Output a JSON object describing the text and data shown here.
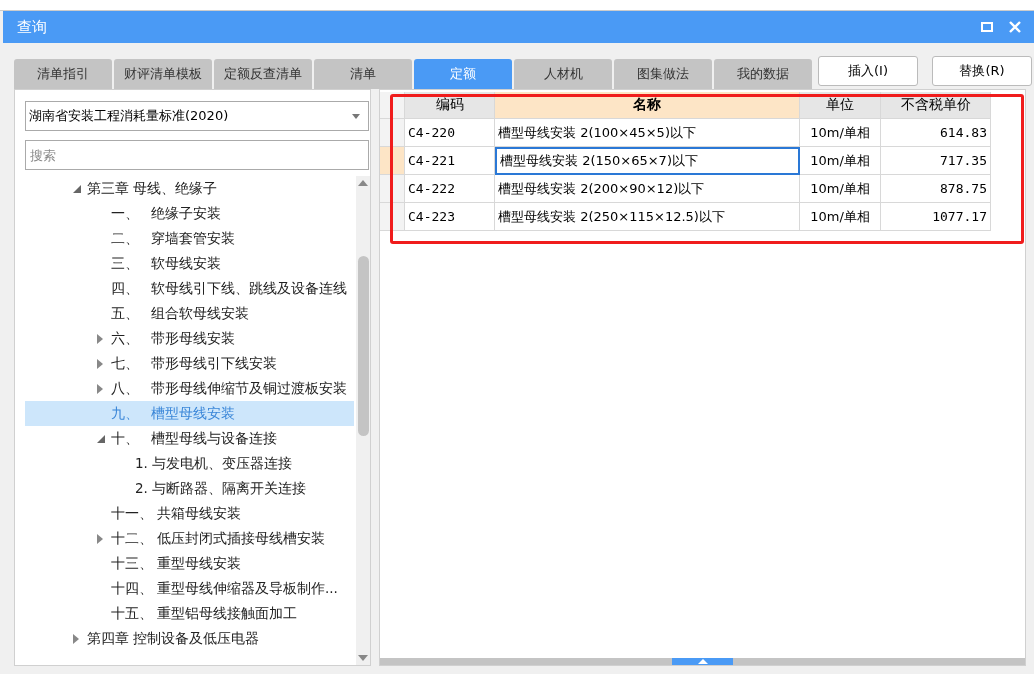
{
  "window": {
    "title": "查询"
  },
  "tabs": [
    {
      "label": "清单指引",
      "selected": false
    },
    {
      "label": "财评清单模板",
      "selected": false
    },
    {
      "label": "定额反查清单",
      "selected": false
    },
    {
      "label": "清单",
      "selected": false
    },
    {
      "label": "定额",
      "selected": true
    },
    {
      "label": "人材机",
      "selected": false
    },
    {
      "label": "图集做法",
      "selected": false
    },
    {
      "label": "我的数据",
      "selected": false
    }
  ],
  "buttons": [
    "插入(I)",
    "替换(R)"
  ],
  "library_select": {
    "value": "湖南省安装工程消耗量标准(2020)"
  },
  "search": {
    "placeholder": "搜索"
  },
  "tree": [
    {
      "label": "第三章 母线、绝缘子",
      "expanded": true,
      "selected": false,
      "children": [
        {
          "number": "一、",
          "label": "绝缘子安装",
          "selected": false
        },
        {
          "number": "二、",
          "label": "穿墙套管安装",
          "selected": false
        },
        {
          "number": "三、",
          "label": "软母线安装",
          "selected": false
        },
        {
          "number": "四、",
          "label": "软母线引下线、跳线及设备连线",
          "selected": false
        },
        {
          "number": "五、",
          "label": "组合软母线安装",
          "selected": false
        },
        {
          "number": "六、",
          "label": "带形母线安装",
          "expanded": false,
          "selected": false
        },
        {
          "number": "七、",
          "label": "带形母线引下线安装",
          "expanded": false,
          "selected": false
        },
        {
          "number": "八、",
          "label": "带形母线伸缩节及铜过渡板安装",
          "expanded": false,
          "selected": false
        },
        {
          "number": "九、",
          "label": "槽型母线安装",
          "selected": true
        },
        {
          "number": "十、",
          "label": "槽型母线与设备连接",
          "expanded": true,
          "selected": false,
          "children": [
            {
              "label": "1. 与发电机、变压器连接",
              "selected": false
            },
            {
              "label": "2. 与断路器、隔离开关连接",
              "selected": false
            }
          ]
        },
        {
          "number": "十一、",
          "label": "共箱母线安装",
          "selected": false
        },
        {
          "number": "十二、",
          "label": "低压封闭式插接母线槽安装",
          "expanded": false,
          "selected": false
        },
        {
          "number": "十三、",
          "label": "重型母线安装",
          "selected": false
        },
        {
          "number": "十四、",
          "label": "重型母线伸缩器及导板制作...",
          "selected": false
        },
        {
          "number": "十五、",
          "label": "重型铝母线接触面加工",
          "selected": false
        }
      ]
    },
    {
      "label": "第四章 控制设备及低压电器",
      "expanded": false,
      "selected": false
    }
  ],
  "table": {
    "columns": [
      "编码",
      "名称",
      "单位",
      "不含税单价"
    ],
    "rows": [
      {
        "cells": [
          "C4-220",
          "槽型母线安装 2(100×45×5)以下",
          "10m/单相",
          "614.83"
        ],
        "selected": false
      },
      {
        "cells": [
          "C4-221",
          "槽型母线安装 2(150×65×7)以下",
          "10m/单相",
          "717.35"
        ],
        "selected": true
      },
      {
        "cells": [
          "C4-222",
          "槽型母线安装 2(200×90×12)以下",
          "10m/单相",
          "878.75"
        ],
        "selected": false
      },
      {
        "cells": [
          "C4-223",
          "槽型母线安装 2(250×115×12.5)以下",
          "10m/单相",
          "1077.17"
        ],
        "selected": false
      }
    ]
  }
}
